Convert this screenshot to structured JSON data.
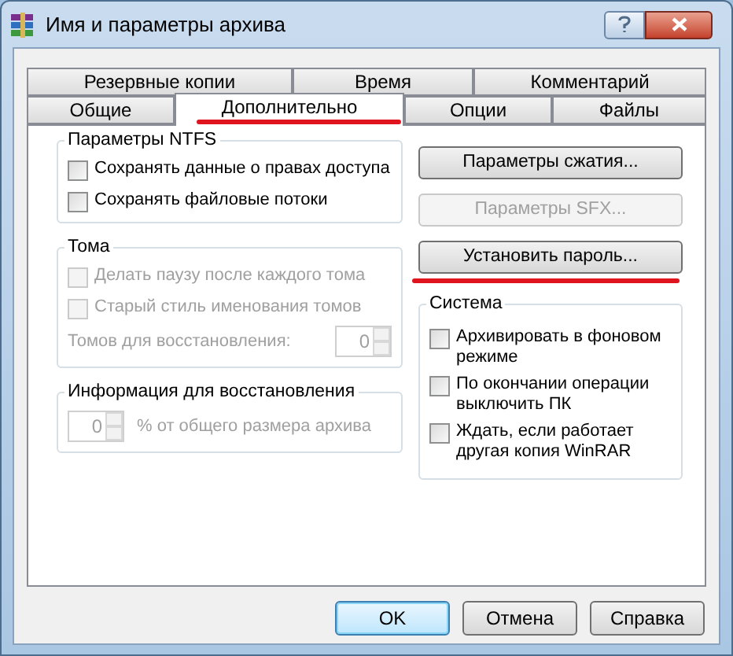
{
  "window": {
    "title": "Имя и параметры архива"
  },
  "tabs": [
    [
      {
        "label": "Резервные копии",
        "selected": false,
        "underlined": false
      },
      {
        "label": "Время",
        "selected": false,
        "underlined": false
      },
      {
        "label": "Комментарий",
        "selected": false,
        "underlined": false
      }
    ],
    [
      {
        "label": "Общие",
        "selected": false,
        "underlined": false
      },
      {
        "label": "Дополнительно",
        "selected": true,
        "underlined": true
      },
      {
        "label": "Опции",
        "selected": false,
        "underlined": false
      },
      {
        "label": "Файлы",
        "selected": false,
        "underlined": false
      }
    ]
  ],
  "ntfs": {
    "title": "Параметры NTFS",
    "options": [
      {
        "label": "Сохранять данные о правах доступа",
        "checked": false,
        "disabled": false
      },
      {
        "label": "Сохранять файловые потоки",
        "checked": false,
        "disabled": false
      }
    ]
  },
  "volumes": {
    "title": "Тома",
    "options": [
      {
        "label": "Делать паузу после каждого тома",
        "checked": false,
        "disabled": true
      },
      {
        "label": "Старый стиль именования томов",
        "checked": false,
        "disabled": true
      }
    ],
    "recovery_volumes": {
      "label": "Томов для восстановления:",
      "value": "0",
      "disabled": true
    }
  },
  "recovery": {
    "title": "Информация для восстановления",
    "value": "0",
    "label": "% от общего размера архива",
    "disabled": true
  },
  "buttons": [
    {
      "label": "Параметры сжатия...",
      "disabled": false,
      "underlined": false
    },
    {
      "label": "Параметры SFX...",
      "disabled": true,
      "underlined": false
    },
    {
      "label": "Установить пароль...",
      "disabled": false,
      "underlined": true
    }
  ],
  "system": {
    "title": "Система",
    "options": [
      {
        "label": "Архивировать в фоновом режиме",
        "checked": false,
        "disabled": false
      },
      {
        "label": "По окончании операции выключить ПК",
        "checked": false,
        "disabled": false
      },
      {
        "label": "Ждать, если работает другая копия WinRAR",
        "checked": false,
        "disabled": false
      }
    ]
  },
  "footer": [
    {
      "label": "OK",
      "default": true
    },
    {
      "label": "Отмена",
      "default": false
    },
    {
      "label": "Справка",
      "default": false
    }
  ]
}
